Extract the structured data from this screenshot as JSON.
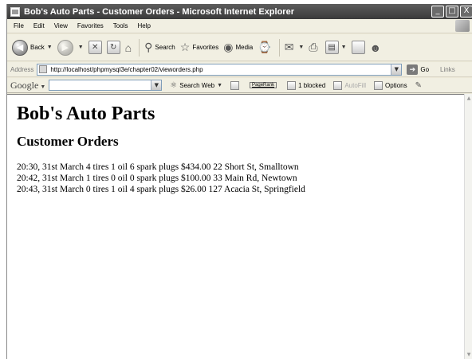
{
  "window": {
    "title": "Bob's Auto Parts - Customer Orders - Microsoft Internet Explorer",
    "caption_buttons": [
      "_",
      "□",
      "X"
    ]
  },
  "menu": [
    "File",
    "Edit",
    "View",
    "Favorites",
    "Tools",
    "Help"
  ],
  "toolbar": {
    "back_label": "Back",
    "search_label": "Search",
    "favorites_label": "Favorites",
    "media_label": "Media"
  },
  "address": {
    "label": "Address",
    "url": "http://localhost/phpmysql3e/chapter02/vieworders.php",
    "go_label": "Go",
    "links_label": "Links"
  },
  "googlebar": {
    "logo": "Google",
    "search_web_label": "Search Web",
    "pagerank_label": "PageRank",
    "blocked_label": "1 blocked",
    "autofill_label": "AutoFill",
    "options_label": "Options"
  },
  "page": {
    "heading": "Bob's Auto Parts",
    "subheading": "Customer Orders",
    "orders": [
      "20:30, 31st March 4 tires 1 oil 6 spark plugs $434.00 22 Short St, Smalltown",
      "20:42, 31st March 1 tires 0 oil 0 spark plugs $100.00 33 Main Rd, Newtown",
      "20:43, 31st March 0 tires 1 oil 4 spark plugs $26.00 127 Acacia St, Springfield"
    ]
  }
}
